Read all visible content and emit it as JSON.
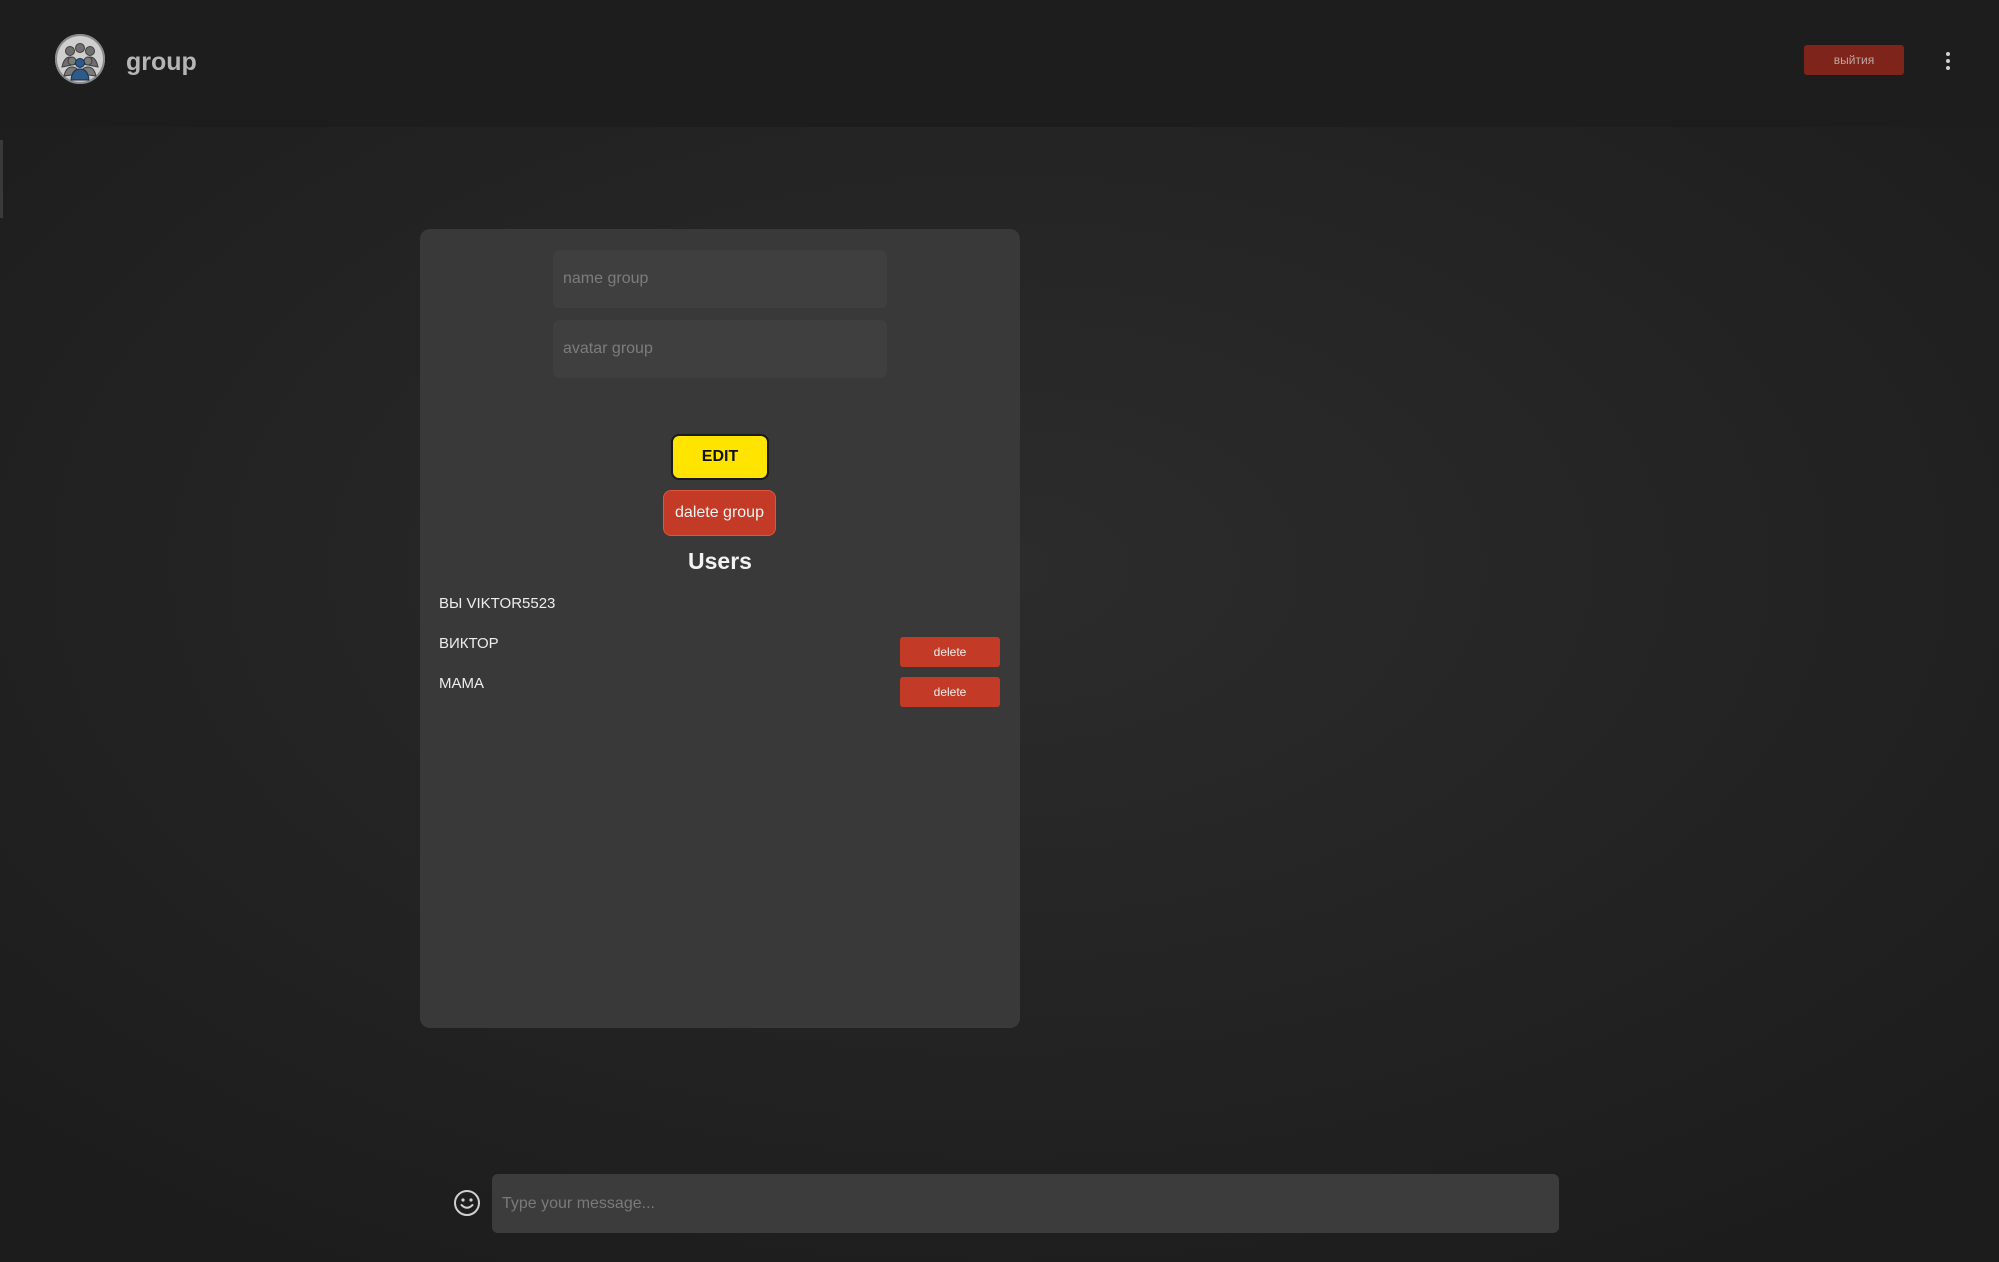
{
  "header": {
    "title": "group",
    "logout_label": "выйтия",
    "avatar_icon": "group-avatar-icon",
    "menu_icon": "kebab-menu-icon"
  },
  "edit_form": {
    "name_placeholder": "name group",
    "avatar_placeholder": "avatar group",
    "edit_label": "EDIT",
    "delete_group_label": "dalete group"
  },
  "users": {
    "heading": "Users",
    "items": [
      {
        "name": "ВЫ VIKTOR5523",
        "delete_label": ""
      },
      {
        "name": "ВИКТОР",
        "delete_label": "delete"
      },
      {
        "name": "МАМА",
        "delete_label": "delete"
      }
    ]
  },
  "message_bar": {
    "placeholder": "Type your message...",
    "emoji_icon": "smiley-icon"
  },
  "colors": {
    "accent_yellow": "#ffe400",
    "danger_red": "#c33a26",
    "logout_red": "#7e241b",
    "panel_bg": "#393939"
  }
}
